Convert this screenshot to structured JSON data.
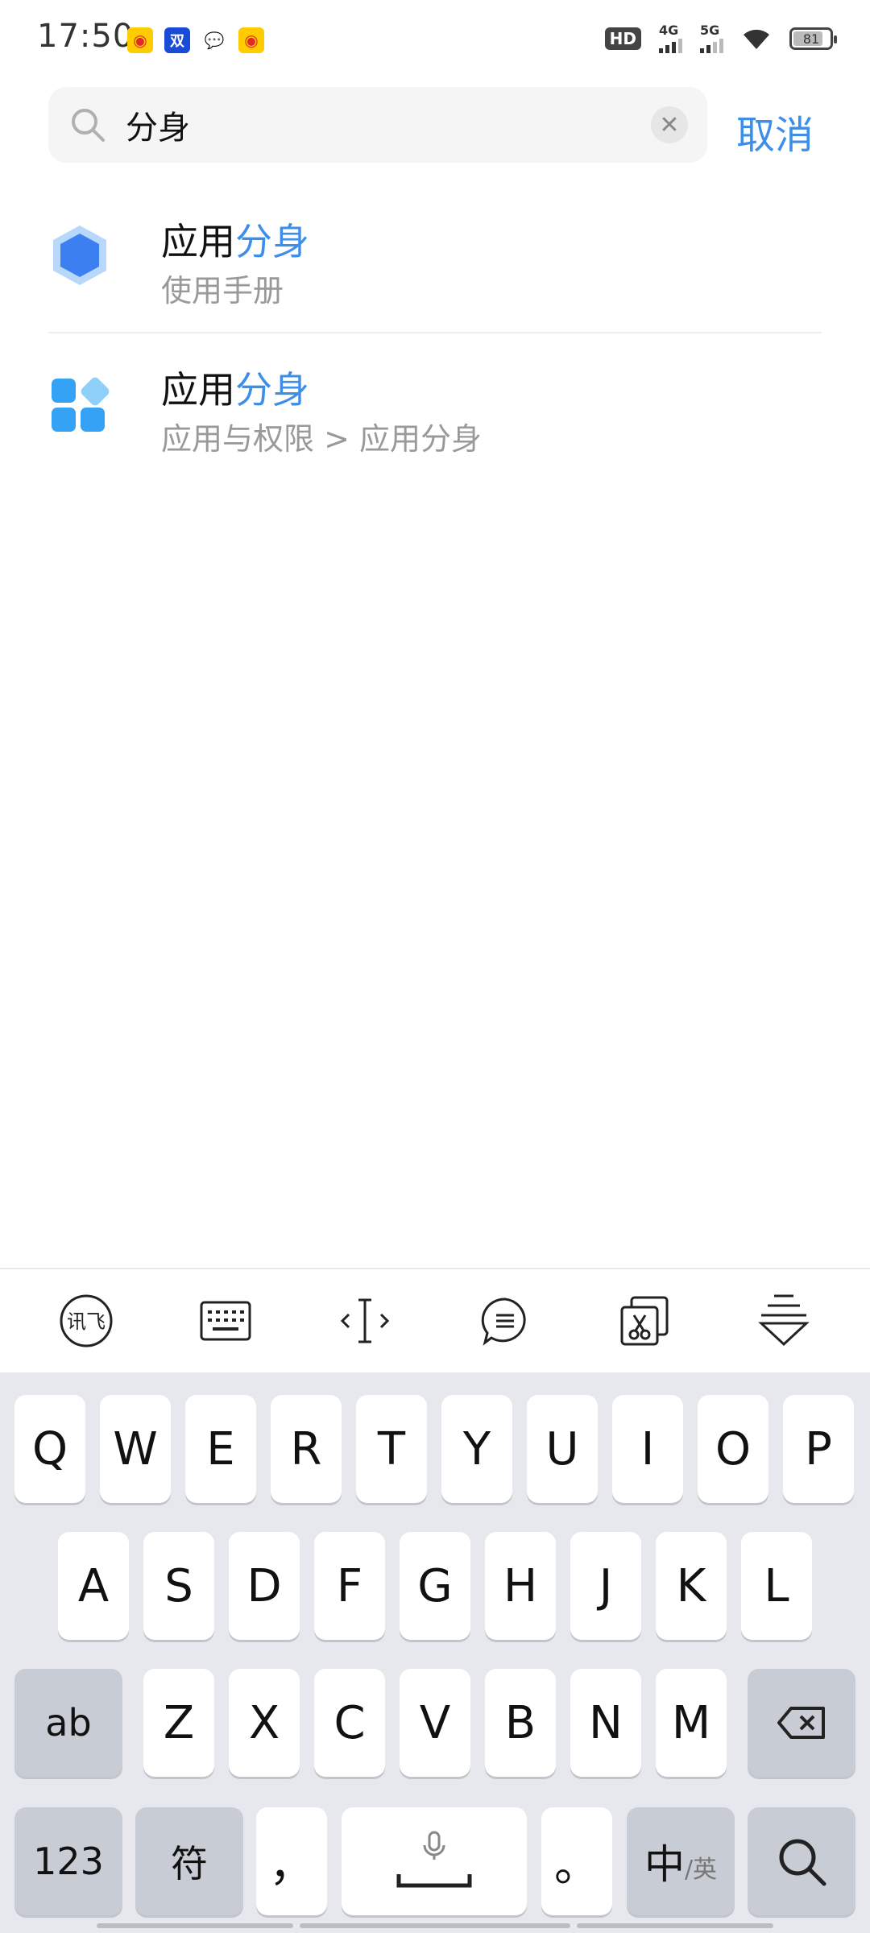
{
  "status_bar": {
    "time": "17:50",
    "notifications": [
      {
        "icon": "weibo-icon",
        "glyph": "◉",
        "kind": "weibo"
      },
      {
        "icon": "bank-app-icon",
        "glyph": "双",
        "kind": "bank"
      },
      {
        "icon": "wechat-icon",
        "glyph": "💬",
        "kind": "wechat"
      },
      {
        "icon": "weibo-icon",
        "glyph": "◉",
        "kind": "weibo"
      }
    ],
    "hd": "HD",
    "network_4g": "4G",
    "network_5g": "5G",
    "battery": "81",
    "battery_level": 0.81
  },
  "search": {
    "query": "分身",
    "clear_glyph": "✕",
    "cancel_label": "取消"
  },
  "results": [
    {
      "title_prefix": "应用",
      "title_highlight": "分身",
      "subtitle": "使用手册",
      "icon": "hexagon-icon"
    },
    {
      "title_prefix": "应用",
      "title_highlight": "分身",
      "subtitle": "应用与权限 > 应用分身",
      "icon": "apps-grid-icon"
    }
  ],
  "keyboard": {
    "row1": [
      "Q",
      "W",
      "E",
      "R",
      "T",
      "Y",
      "U",
      "I",
      "O",
      "P"
    ],
    "row2": [
      "A",
      "S",
      "D",
      "F",
      "G",
      "H",
      "J",
      "K",
      "L"
    ],
    "row3": [
      "Z",
      "X",
      "C",
      "V",
      "B",
      "N",
      "M"
    ],
    "shift_label": "ab",
    "num_label": "123",
    "symbol_label": "符",
    "comma": "，",
    "period": "。",
    "lang_main": "中",
    "lang_alt": "/英"
  },
  "colors": {
    "accent": "#3d8ee8",
    "keyboard_bg": "#e6e8ed",
    "func_key": "#c8ccd4"
  }
}
